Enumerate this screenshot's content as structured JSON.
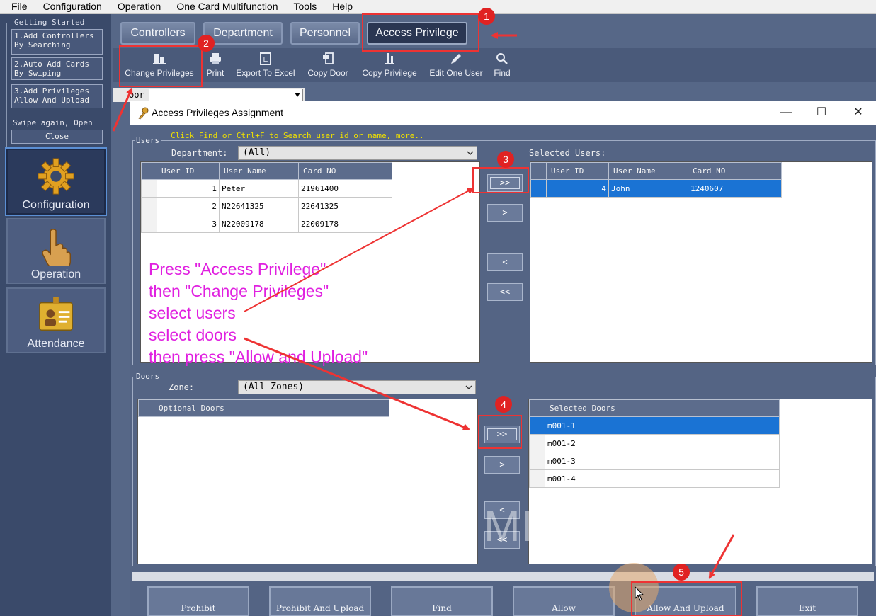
{
  "menubar": {
    "items": [
      "File",
      "Configuration",
      "Operation",
      "One Card Multifunction",
      "Tools",
      "Help"
    ]
  },
  "getting_started": {
    "legend": "Getting Started",
    "step1": "1.Add Controllers\nBy Searching",
    "step2": "2.Auto Add Cards\nBy Swiping",
    "step3": "3.Add Privileges\nAllow And Upload",
    "swipe_text": "Swipe again, Open",
    "close": "Close"
  },
  "nav": {
    "configuration": "Configuration",
    "operation": "Operation",
    "attendance": "Attendance"
  },
  "top_tabs": [
    "Controllers",
    "Department",
    "Personnel",
    "Access Privilege"
  ],
  "toolbar": [
    "Change Privileges",
    "Print",
    "Export To Excel",
    "Copy Door",
    "Copy Privilege",
    "Edit One User",
    "Find"
  ],
  "door_filter": {
    "label": "oor"
  },
  "dialog": {
    "title": "Access Privileges Assignment",
    "controls": {
      "minimize": "—",
      "maximize": "☐",
      "close": "✕"
    },
    "users": {
      "legend": "Users",
      "hint": "Click Find or Ctrl+F  to Search user id or name,  more..",
      "department_label": "Department:",
      "department_value": "(All)",
      "selected_label": "Selected Users:",
      "columns": [
        "User ID",
        "User Name",
        "Card NO"
      ],
      "rows": [
        {
          "id": "1",
          "name": "Peter",
          "card": "21961400"
        },
        {
          "id": "2",
          "name": "N22641325",
          "card": "22641325"
        },
        {
          "id": "3",
          "name": "N22009178",
          "card": "22009178"
        }
      ],
      "selected_rows": [
        {
          "id": "4",
          "name": "John",
          "card": "1240607"
        }
      ]
    },
    "doors": {
      "legend": "Doors",
      "zone_label": "Zone:",
      "zone_value": "(All Zones)",
      "optional_header": "Optional Doors",
      "selected_header": "Selected Doors",
      "selected": [
        "m001-1",
        "m001-2",
        "m001-3",
        "m001-4"
      ]
    },
    "transfer": {
      "add_all": ">>",
      "add_one": ">",
      "remove_one": "<",
      "remove_all": "<<"
    },
    "buttons": [
      "Prohibit",
      "Prohibit And Upload",
      "Find",
      "Allow",
      "Allow And Upload",
      "Exit"
    ]
  },
  "annotations": {
    "badges": [
      "1",
      "2",
      "3",
      "4",
      "5"
    ],
    "instructions": [
      "Press \"Access Privilege\"",
      "then \"Change Privileges\"",
      "select users",
      "select doors",
      "then press \"Allow and Upload\""
    ],
    "watermark": "MENGQI-Control",
    "colors": {
      "box": "#ee3333",
      "text": "#e020e0",
      "badge": "#e02222"
    }
  }
}
